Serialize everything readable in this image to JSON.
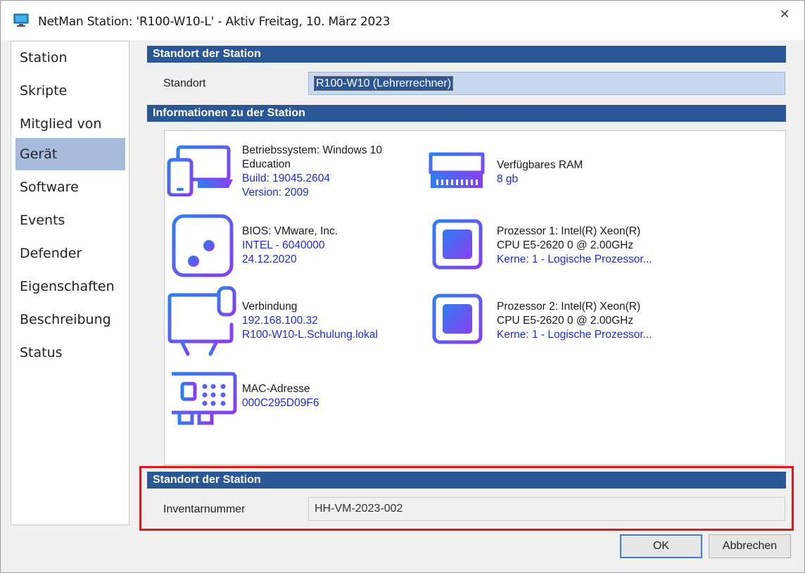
{
  "window": {
    "title": "NetMan Station: 'R100-W10-L' - Aktiv Freitag, 10. März 2023",
    "close_glyph": "✕"
  },
  "sidebar": {
    "items": [
      {
        "label": "Station"
      },
      {
        "label": "Skripte"
      },
      {
        "label": "Mitglied von"
      },
      {
        "label": "Gerät",
        "active": true
      },
      {
        "label": "Software"
      },
      {
        "label": "Events"
      },
      {
        "label": "Defender"
      },
      {
        "label": "Eigenschaften"
      },
      {
        "label": "Beschreibung"
      },
      {
        "label": "Status"
      }
    ]
  },
  "location_section": {
    "header": "Standort der Station",
    "label": "Standort",
    "value": "R100-W10 (Lehrerrechner)"
  },
  "info_section": {
    "header": "Informationen zu der Station",
    "os": {
      "icon": "laptop-phone-icon",
      "line1": "Betriebssystem: Windows 10",
      "line2": "Education",
      "build": "Build: 19045.2604",
      "version": "Version: 2009"
    },
    "ram": {
      "icon": "ram-icon",
      "title": "Verfügbares RAM",
      "value": "8 gb"
    },
    "bios": {
      "icon": "sliders-window-icon",
      "title": "BIOS: VMware, Inc.",
      "line2": "INTEL  - 6040000",
      "line3": "24.12.2020"
    },
    "cpu1": {
      "icon": "cpu-icon",
      "title": "Prozessor 1: Intel(R) Xeon(R)",
      "line2": "CPU E5-2620 0 @ 2.00GHz",
      "line3": "Kerne: 1 - Logische Prozessor..."
    },
    "network": {
      "icon": "monitor-cable-icon",
      "title": "Verbindung",
      "ip": "192.168.100.32",
      "host": "R100-W10-L.Schulung.lokal"
    },
    "cpu2": {
      "icon": "cpu-icon",
      "title": "Prozessor 2: Intel(R) Xeon(R)",
      "line2": "CPU E5-2620 0 @ 2.00GHz",
      "line3": "Kerne: 1 - Logische Prozessor..."
    },
    "mac": {
      "icon": "network-card-icon",
      "title": "MAC-Adresse",
      "value": "000C295D09F6"
    }
  },
  "inventory_section": {
    "header": "Standort der Station",
    "label": "Inventarnummer",
    "value": "HH-VM-2023-002"
  },
  "buttons": {
    "ok": "OK",
    "cancel": "Abbrechen"
  },
  "colors": {
    "header_bg": "#2b5797",
    "accent_blue": "#1f2ad6",
    "highlight_red": "#e0161b",
    "icon_gradient_start": "#2d7ff0",
    "icon_gradient_end": "#8a3df0"
  }
}
